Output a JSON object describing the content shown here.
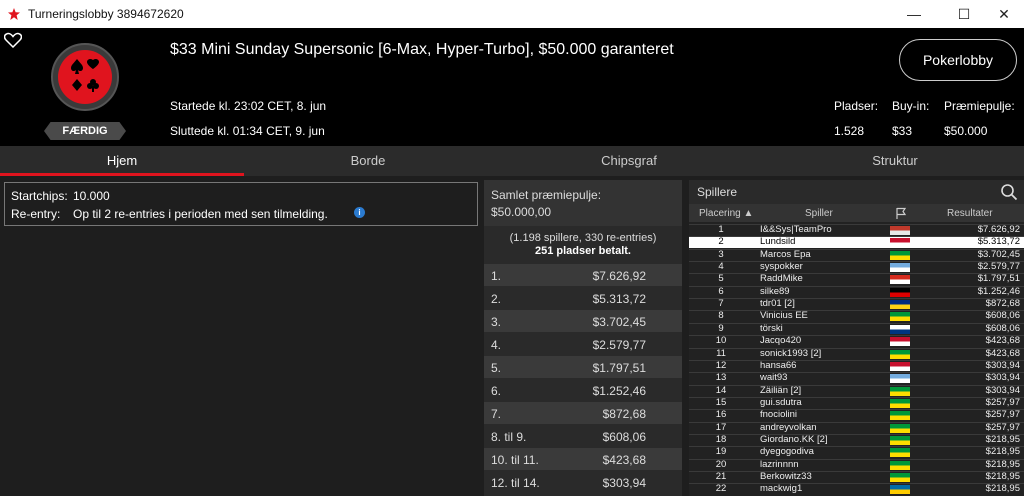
{
  "window": {
    "title": "Turneringslobby 3894672620",
    "min": "—",
    "max": "☐",
    "close": "✕"
  },
  "tournament": {
    "name": "$33 Mini Sunday Supersonic [6-Max, Hyper-Turbo], $50.000 garanteret",
    "status": "FÆRDIG",
    "started": "Startede kl. 23:02 CET, 8. jun",
    "ended": "Sluttede kl. 01:34 CET, 9. jun"
  },
  "header": {
    "lobby_button": "Pokerlobby",
    "seats_label": "Pladser:",
    "seats": "1.528",
    "buyin_label": "Buy-in:",
    "buyin": "$33",
    "pool_label": "Præmiepulje:",
    "pool": "$50.000"
  },
  "tabs": [
    "Hjem",
    "Borde",
    "Chipsgraf",
    "Struktur"
  ],
  "info": {
    "chips_label": "Startchips:",
    "chips": "10.000",
    "reentry_label": "Re-entry:",
    "reentry": "Op til 2 re-entries i perioden med sen tilmelding.",
    "info_icon": "i"
  },
  "prize": {
    "title": "Samlet præmiepulje:",
    "total": "$50.000,00",
    "players": "(1.198 spillere, 330 re-entries)",
    "paid": "251 pladser betalt.",
    "rows": [
      {
        "p": "1.",
        "v": "$7.626,92"
      },
      {
        "p": "2.",
        "v": "$5.313,72"
      },
      {
        "p": "3.",
        "v": "$3.702,45"
      },
      {
        "p": "4.",
        "v": "$2.579,77"
      },
      {
        "p": "5.",
        "v": "$1.797,51"
      },
      {
        "p": "6.",
        "v": "$1.252,46"
      },
      {
        "p": "7.",
        "v": "$872,68"
      },
      {
        "p": "8. til 9.",
        "v": "$608,06"
      },
      {
        "p": "10. til 11.",
        "v": "$423,68"
      },
      {
        "p": "12. til 14.",
        "v": "$303,94"
      }
    ]
  },
  "players": {
    "title": "Spillere",
    "col_place": "Placering ▲",
    "col_player": "Spiller",
    "col_result": "Resultater",
    "search_icon": "search-icon",
    "flag_icon": "flag-icon",
    "rows": [
      {
        "r": "1",
        "n": "I&&Sys|TeamPro",
        "f": [
          "#c0392b",
          "#e8e8e8"
        ],
        "v": "$7.626,92"
      },
      {
        "r": "2",
        "n": "Lundsild",
        "f": [
          "#c8102e",
          "#ffffff"
        ],
        "v": "$5.313,72"
      },
      {
        "r": "3",
        "n": "Marcos Epa",
        "f": [
          "#009739",
          "#fedd00"
        ],
        "v": "$3.702,45"
      },
      {
        "r": "4",
        "n": "syspokker",
        "f": [
          "#74acdf",
          "#ffffff"
        ],
        "v": "$2.579,77"
      },
      {
        "r": "5",
        "n": "RaddMike",
        "f": [
          "#d52b1e",
          "#ffffff"
        ],
        "v": "$1.797,51"
      },
      {
        "r": "6",
        "n": "silke89",
        "f": [
          "#000000",
          "#dd0000"
        ],
        "v": "$1.252,46"
      },
      {
        "r": "7",
        "n": "tdr01 [2]",
        "f": [
          "#002b7f",
          "#fcd116"
        ],
        "v": "$872,68"
      },
      {
        "r": "8",
        "n": "Vinicius EE",
        "f": [
          "#009739",
          "#fedd00"
        ],
        "v": "$608,06"
      },
      {
        "r": "9",
        "n": "törski",
        "f": [
          "#ffffff",
          "#003580"
        ],
        "v": "$608,06"
      },
      {
        "r": "10",
        "n": "Jacqo420",
        "f": [
          "#c8102e",
          "#ffffff"
        ],
        "v": "$423,68"
      },
      {
        "r": "11",
        "n": "sonick1993 [2]",
        "f": [
          "#009739",
          "#fedd00"
        ],
        "v": "$423,68"
      },
      {
        "r": "12",
        "n": "hansa66",
        "f": [
          "#c8102e",
          "#ffffff"
        ],
        "v": "$303,94"
      },
      {
        "r": "13",
        "n": "wait93",
        "f": [
          "#74acdf",
          "#ffffff"
        ],
        "v": "$303,94"
      },
      {
        "r": "14",
        "n": "Zäiliän [2]",
        "f": [
          "#009739",
          "#fedd00"
        ],
        "v": "$303,94"
      },
      {
        "r": "15",
        "n": "gui.sdutra",
        "f": [
          "#009739",
          "#fedd00"
        ],
        "v": "$257,97"
      },
      {
        "r": "16",
        "n": "fnociolini",
        "f": [
          "#009739",
          "#fedd00"
        ],
        "v": "$257,97"
      },
      {
        "r": "17",
        "n": "andreyvolkan",
        "f": [
          "#009739",
          "#fedd00"
        ],
        "v": "$257,97"
      },
      {
        "r": "18",
        "n": "Giordano.KK [2]",
        "f": [
          "#009739",
          "#fedd00"
        ],
        "v": "$218,95"
      },
      {
        "r": "19",
        "n": "dyegogodiva",
        "f": [
          "#009739",
          "#fedd00"
        ],
        "v": "$218,95"
      },
      {
        "r": "20",
        "n": "lazrinnnn",
        "f": [
          "#009739",
          "#fedd00"
        ],
        "v": "$218,95"
      },
      {
        "r": "21",
        "n": "Berkowitz33",
        "f": [
          "#009739",
          "#fedd00"
        ],
        "v": "$218,95"
      },
      {
        "r": "22",
        "n": "mackwig1",
        "f": [
          "#006aa7",
          "#fecc00"
        ],
        "v": "$218,95"
      }
    ]
  }
}
